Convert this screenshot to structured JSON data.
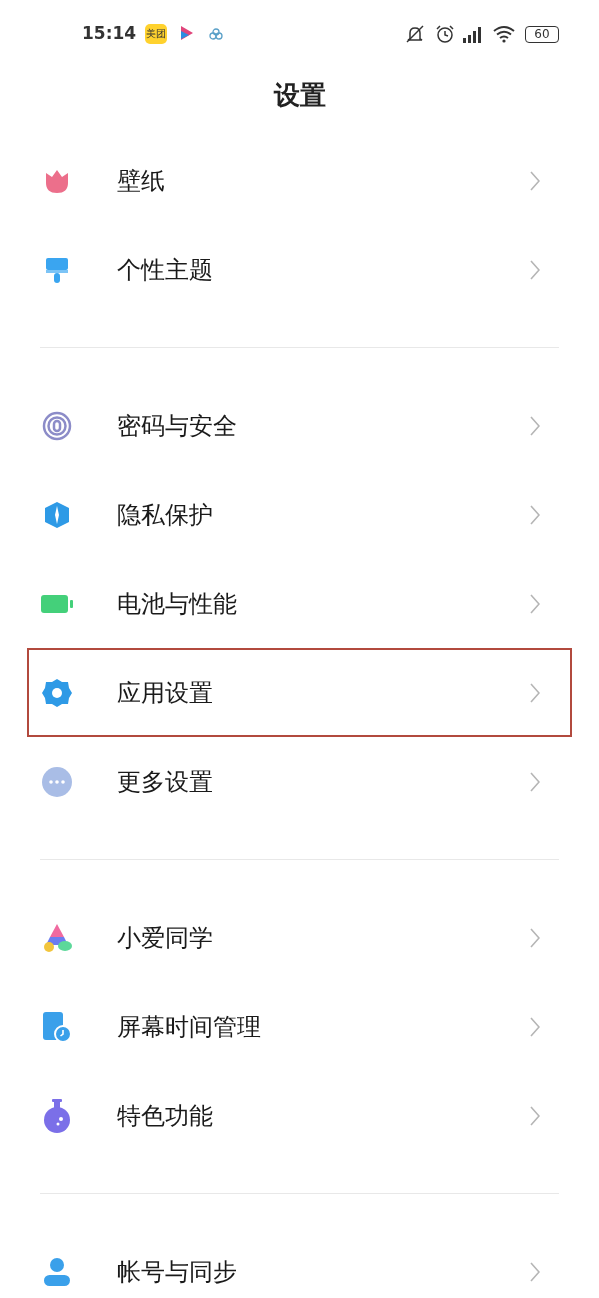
{
  "status_bar": {
    "time": "15:14",
    "app_badge": "美团",
    "battery": "60"
  },
  "title": "设置",
  "groups": [
    {
      "items": [
        {
          "label": "壁纸",
          "kind": "tulip",
          "highlighted": false
        },
        {
          "label": "个性主题",
          "kind": "brush",
          "highlighted": false
        }
      ]
    },
    {
      "items": [
        {
          "label": "密码与安全",
          "kind": "fingerprint",
          "highlighted": false
        },
        {
          "label": "隐私保护",
          "kind": "shield",
          "highlighted": false
        },
        {
          "label": "电池与性能",
          "kind": "battery",
          "highlighted": false
        },
        {
          "label": "应用设置",
          "kind": "gear",
          "highlighted": true
        },
        {
          "label": "更多设置",
          "kind": "more",
          "highlighted": false
        }
      ]
    },
    {
      "items": [
        {
          "label": "小爱同学",
          "kind": "assistant",
          "highlighted": false
        },
        {
          "label": "屏幕时间管理",
          "kind": "screentime",
          "highlighted": false
        },
        {
          "label": "特色功能",
          "kind": "flask",
          "highlighted": false
        }
      ]
    },
    {
      "items": [
        {
          "label": "帐号与同步",
          "kind": "account",
          "highlighted": false
        }
      ]
    }
  ]
}
